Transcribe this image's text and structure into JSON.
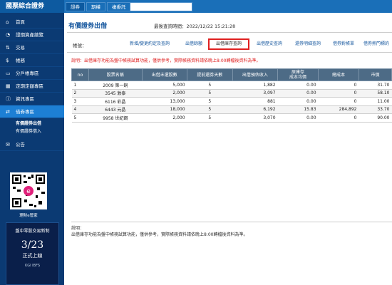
{
  "brand": {
    "name": "國票綜合證券"
  },
  "top_tabs": [
    {
      "label": "證券"
    },
    {
      "label": "期權"
    },
    {
      "label": "複委託"
    }
  ],
  "sidebar": {
    "items": [
      {
        "label": "首頁",
        "icon": "home-icon"
      },
      {
        "label": "證期資產總覽",
        "icon": "portfolio-icon"
      },
      {
        "label": "交易",
        "icon": "trade-icon"
      },
      {
        "label": "帳務",
        "icon": "account-icon"
      },
      {
        "label": "分戶帳專區",
        "icon": "ledger-icon"
      },
      {
        "label": "定期定額專區",
        "icon": "calendar-icon"
      },
      {
        "label": "資訊專區",
        "icon": "info-icon"
      },
      {
        "label": "借券專區",
        "icon": "lending-icon"
      }
    ],
    "sub_items": [
      {
        "label": "有價證券出借"
      },
      {
        "label": "有價證券借入"
      }
    ],
    "after_items": [
      {
        "label": "公告",
        "icon": "announcement-icon"
      }
    ],
    "qr_label": "理財e管家",
    "ad": {
      "line1": "盤中零股交易新制",
      "line2": "3/23",
      "line3": "正式上線",
      "line4": "KGI IBFS"
    }
  },
  "page": {
    "title": "有價證券出借",
    "query_time": "最後查詢時間：2022/12/22 15:21:28",
    "account_label": "帳號：",
    "tabs": [
      {
        "label": "新增/變更約定及查詢"
      },
      {
        "label": "出借餘額"
      },
      {
        "label": "出借庫存查詢"
      },
      {
        "label": "出借歷史查詢"
      },
      {
        "label": "還券明細查詢"
      },
      {
        "label": "借券對帳單"
      },
      {
        "label": "借券熱門標的"
      }
    ],
    "notice": "說明：出借庫存功能為盤中帳務試算功能，僅供參考，實際帳務資料請依晚上8:00轉檔後資料為準。"
  },
  "table": {
    "headers": [
      "no",
      "股票名稱",
      "出借未還股數",
      "提前還券天數",
      "出借預估收入",
      "原庫存\n成本均價",
      "總成本",
      "市價"
    ],
    "rows": [
      {
        "no": "1",
        "name": "2009 第一銅",
        "shares": "5,000",
        "days": "5",
        "income": "1,882",
        "avg_cost": "0.00",
        "total_cost": "0",
        "price": "31.70"
      },
      {
        "no": "2",
        "name": "3545 敦泰",
        "shares": "2,000",
        "days": "5",
        "income": "3,097",
        "avg_cost": "0.00",
        "total_cost": "0",
        "price": "58.10"
      },
      {
        "no": "3",
        "name": "6116 彩晶",
        "shares": "13,000",
        "days": "5",
        "income": "881",
        "avg_cost": "0.00",
        "total_cost": "0",
        "price": "11.00"
      },
      {
        "no": "4",
        "name": "6443 元晶",
        "shares": "18,000",
        "days": "5",
        "income": "6,192",
        "avg_cost": "15.83",
        "total_cost": "284,892",
        "price": "33.70"
      },
      {
        "no": "5",
        "name": "9958 世紀鋼",
        "shares": "2,000",
        "days": "5",
        "income": "3,070",
        "avg_cost": "0.00",
        "total_cost": "0",
        "price": "90.00"
      }
    ]
  },
  "footer": {
    "title": "說明：",
    "text": "出借庫存功能為盤中帳務試算功能，僅供參考，實際帳務資料請依晚上8:00轉檔後資料為準。"
  }
}
